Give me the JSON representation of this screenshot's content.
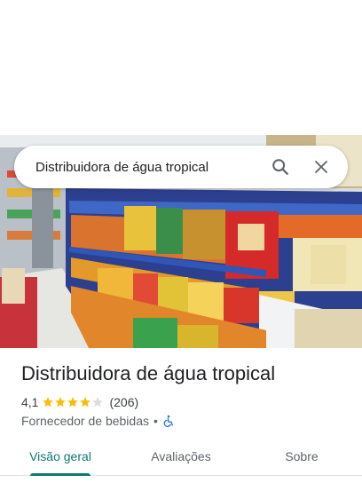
{
  "search": {
    "query": "Distribuidora de água tropical",
    "search_icon": "search-icon",
    "close_icon": "close-icon"
  },
  "photo": {
    "description_icon": "store-photo"
  },
  "place": {
    "name": "Distribuidora de água tropical",
    "rating": "4,1",
    "rating_value": 4.1,
    "rating_max": 5,
    "review_count": "(206)",
    "category": "Fornecedor de bebidas",
    "separator": "•",
    "accessibility_icon": "wheelchair-icon"
  },
  "tabs": [
    {
      "label": "Visão geral",
      "active": true
    },
    {
      "label": "Avaliações",
      "active": false
    },
    {
      "label": "Sobre",
      "active": false
    }
  ],
  "colors": {
    "accent": "#0b7a75",
    "star": "#fbbc04",
    "star_empty": "#dadce0",
    "accessibility": "#1a73e8"
  }
}
